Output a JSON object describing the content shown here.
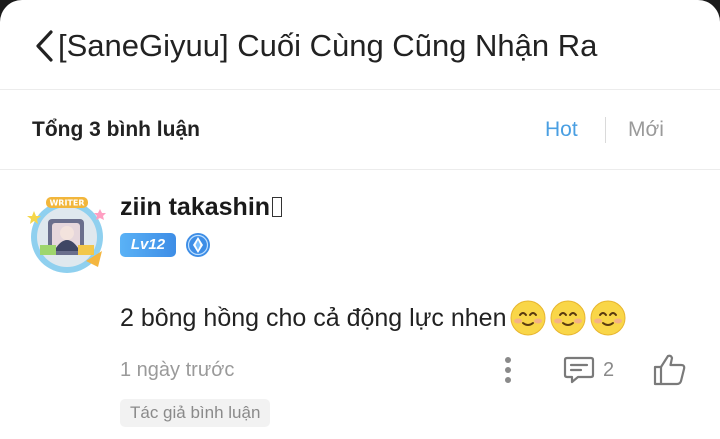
{
  "header": {
    "title": "[SaneGiyuu] Cuối Cùng Cũng Nhận Ra",
    "back_icon": "chevron-left-icon"
  },
  "summary": {
    "total_label": "Tổng 3 bình luận",
    "sort_hot": "Hot",
    "sort_new": "Mới",
    "active_sort_color": "#4a9fe2"
  },
  "comment": {
    "username": "ziin takashin",
    "level": "Lv12",
    "avatar_frame_text": "WRITER",
    "text": "2 bông hồng cho cả động lực nhen",
    "emoji_count": 3,
    "timestamp": "1 ngày trước",
    "reply_count": "2",
    "author_tag": "Tác giả bình luận"
  }
}
